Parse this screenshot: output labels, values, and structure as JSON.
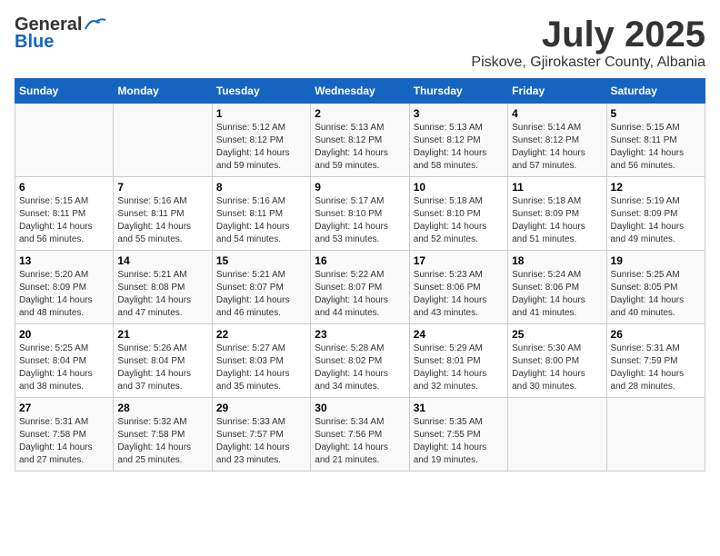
{
  "logo": {
    "general": "General",
    "blue": "Blue"
  },
  "title": "July 2025",
  "location": "Piskove, Gjirokaster County, Albania",
  "days_of_week": [
    "Sunday",
    "Monday",
    "Tuesday",
    "Wednesday",
    "Thursday",
    "Friday",
    "Saturday"
  ],
  "weeks": [
    [
      {
        "day": "",
        "sunrise": "",
        "sunset": "",
        "daylight": ""
      },
      {
        "day": "",
        "sunrise": "",
        "sunset": "",
        "daylight": ""
      },
      {
        "day": "1",
        "sunrise": "Sunrise: 5:12 AM",
        "sunset": "Sunset: 8:12 PM",
        "daylight": "Daylight: 14 hours and 59 minutes."
      },
      {
        "day": "2",
        "sunrise": "Sunrise: 5:13 AM",
        "sunset": "Sunset: 8:12 PM",
        "daylight": "Daylight: 14 hours and 59 minutes."
      },
      {
        "day": "3",
        "sunrise": "Sunrise: 5:13 AM",
        "sunset": "Sunset: 8:12 PM",
        "daylight": "Daylight: 14 hours and 58 minutes."
      },
      {
        "day": "4",
        "sunrise": "Sunrise: 5:14 AM",
        "sunset": "Sunset: 8:12 PM",
        "daylight": "Daylight: 14 hours and 57 minutes."
      },
      {
        "day": "5",
        "sunrise": "Sunrise: 5:15 AM",
        "sunset": "Sunset: 8:11 PM",
        "daylight": "Daylight: 14 hours and 56 minutes."
      }
    ],
    [
      {
        "day": "6",
        "sunrise": "Sunrise: 5:15 AM",
        "sunset": "Sunset: 8:11 PM",
        "daylight": "Daylight: 14 hours and 56 minutes."
      },
      {
        "day": "7",
        "sunrise": "Sunrise: 5:16 AM",
        "sunset": "Sunset: 8:11 PM",
        "daylight": "Daylight: 14 hours and 55 minutes."
      },
      {
        "day": "8",
        "sunrise": "Sunrise: 5:16 AM",
        "sunset": "Sunset: 8:11 PM",
        "daylight": "Daylight: 14 hours and 54 minutes."
      },
      {
        "day": "9",
        "sunrise": "Sunrise: 5:17 AM",
        "sunset": "Sunset: 8:10 PM",
        "daylight": "Daylight: 14 hours and 53 minutes."
      },
      {
        "day": "10",
        "sunrise": "Sunrise: 5:18 AM",
        "sunset": "Sunset: 8:10 PM",
        "daylight": "Daylight: 14 hours and 52 minutes."
      },
      {
        "day": "11",
        "sunrise": "Sunrise: 5:18 AM",
        "sunset": "Sunset: 8:09 PM",
        "daylight": "Daylight: 14 hours and 51 minutes."
      },
      {
        "day": "12",
        "sunrise": "Sunrise: 5:19 AM",
        "sunset": "Sunset: 8:09 PM",
        "daylight": "Daylight: 14 hours and 49 minutes."
      }
    ],
    [
      {
        "day": "13",
        "sunrise": "Sunrise: 5:20 AM",
        "sunset": "Sunset: 8:09 PM",
        "daylight": "Daylight: 14 hours and 48 minutes."
      },
      {
        "day": "14",
        "sunrise": "Sunrise: 5:21 AM",
        "sunset": "Sunset: 8:08 PM",
        "daylight": "Daylight: 14 hours and 47 minutes."
      },
      {
        "day": "15",
        "sunrise": "Sunrise: 5:21 AM",
        "sunset": "Sunset: 8:07 PM",
        "daylight": "Daylight: 14 hours and 46 minutes."
      },
      {
        "day": "16",
        "sunrise": "Sunrise: 5:22 AM",
        "sunset": "Sunset: 8:07 PM",
        "daylight": "Daylight: 14 hours and 44 minutes."
      },
      {
        "day": "17",
        "sunrise": "Sunrise: 5:23 AM",
        "sunset": "Sunset: 8:06 PM",
        "daylight": "Daylight: 14 hours and 43 minutes."
      },
      {
        "day": "18",
        "sunrise": "Sunrise: 5:24 AM",
        "sunset": "Sunset: 8:06 PM",
        "daylight": "Daylight: 14 hours and 41 minutes."
      },
      {
        "day": "19",
        "sunrise": "Sunrise: 5:25 AM",
        "sunset": "Sunset: 8:05 PM",
        "daylight": "Daylight: 14 hours and 40 minutes."
      }
    ],
    [
      {
        "day": "20",
        "sunrise": "Sunrise: 5:25 AM",
        "sunset": "Sunset: 8:04 PM",
        "daylight": "Daylight: 14 hours and 38 minutes."
      },
      {
        "day": "21",
        "sunrise": "Sunrise: 5:26 AM",
        "sunset": "Sunset: 8:04 PM",
        "daylight": "Daylight: 14 hours and 37 minutes."
      },
      {
        "day": "22",
        "sunrise": "Sunrise: 5:27 AM",
        "sunset": "Sunset: 8:03 PM",
        "daylight": "Daylight: 14 hours and 35 minutes."
      },
      {
        "day": "23",
        "sunrise": "Sunrise: 5:28 AM",
        "sunset": "Sunset: 8:02 PM",
        "daylight": "Daylight: 14 hours and 34 minutes."
      },
      {
        "day": "24",
        "sunrise": "Sunrise: 5:29 AM",
        "sunset": "Sunset: 8:01 PM",
        "daylight": "Daylight: 14 hours and 32 minutes."
      },
      {
        "day": "25",
        "sunrise": "Sunrise: 5:30 AM",
        "sunset": "Sunset: 8:00 PM",
        "daylight": "Daylight: 14 hours and 30 minutes."
      },
      {
        "day": "26",
        "sunrise": "Sunrise: 5:31 AM",
        "sunset": "Sunset: 7:59 PM",
        "daylight": "Daylight: 14 hours and 28 minutes."
      }
    ],
    [
      {
        "day": "27",
        "sunrise": "Sunrise: 5:31 AM",
        "sunset": "Sunset: 7:58 PM",
        "daylight": "Daylight: 14 hours and 27 minutes."
      },
      {
        "day": "28",
        "sunrise": "Sunrise: 5:32 AM",
        "sunset": "Sunset: 7:58 PM",
        "daylight": "Daylight: 14 hours and 25 minutes."
      },
      {
        "day": "29",
        "sunrise": "Sunrise: 5:33 AM",
        "sunset": "Sunset: 7:57 PM",
        "daylight": "Daylight: 14 hours and 23 minutes."
      },
      {
        "day": "30",
        "sunrise": "Sunrise: 5:34 AM",
        "sunset": "Sunset: 7:56 PM",
        "daylight": "Daylight: 14 hours and 21 minutes."
      },
      {
        "day": "31",
        "sunrise": "Sunrise: 5:35 AM",
        "sunset": "Sunset: 7:55 PM",
        "daylight": "Daylight: 14 hours and 19 minutes."
      },
      {
        "day": "",
        "sunrise": "",
        "sunset": "",
        "daylight": ""
      },
      {
        "day": "",
        "sunrise": "",
        "sunset": "",
        "daylight": ""
      }
    ]
  ]
}
